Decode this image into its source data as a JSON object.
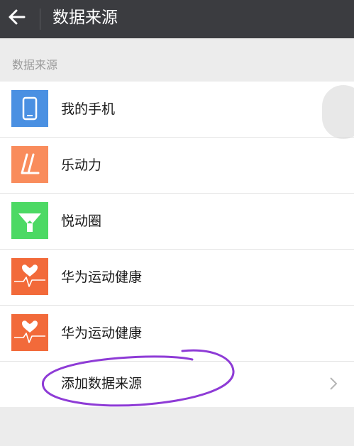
{
  "header": {
    "title": "数据来源"
  },
  "section": {
    "label": "数据来源"
  },
  "sources": [
    {
      "label": "我的手机",
      "icon": "phone-icon",
      "color": "#4a90e2"
    },
    {
      "label": "乐动力",
      "icon": "ledongli-icon",
      "color": "#f98c5c"
    },
    {
      "label": "悦动圈",
      "icon": "yuedongquan-icon",
      "color": "#4cd964"
    },
    {
      "label": "华为运动健康",
      "icon": "huawei-health-icon",
      "color": "#f26a3a"
    },
    {
      "label": "华为运动健康",
      "icon": "huawei-health-icon",
      "color": "#f26a3a"
    }
  ],
  "add": {
    "label": "添加数据来源"
  },
  "annotation": {
    "color": "#8e3bd6"
  }
}
